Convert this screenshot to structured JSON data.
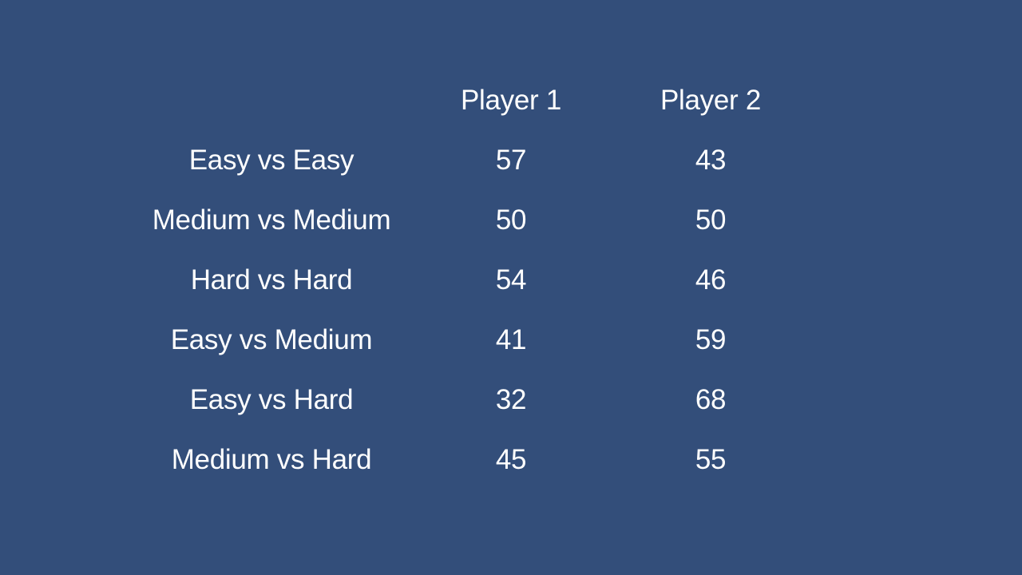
{
  "background_color": "#334e7a",
  "text_color": "#ffffff",
  "table": {
    "columns": [
      "Player 1",
      "Player 2"
    ],
    "rows": [
      {
        "matchup": "Easy vs Easy",
        "player1": "57",
        "player2": "43"
      },
      {
        "matchup": "Medium vs Medium",
        "player1": "50",
        "player2": "50"
      },
      {
        "matchup": "Hard vs Hard",
        "player1": "54",
        "player2": "46"
      },
      {
        "matchup": "Easy vs Medium",
        "player1": "41",
        "player2": "59"
      },
      {
        "matchup": "Easy vs Hard",
        "player1": "32",
        "player2": "68"
      },
      {
        "matchup": "Medium vs Hard",
        "player1": "45",
        "player2": "55"
      }
    ]
  }
}
